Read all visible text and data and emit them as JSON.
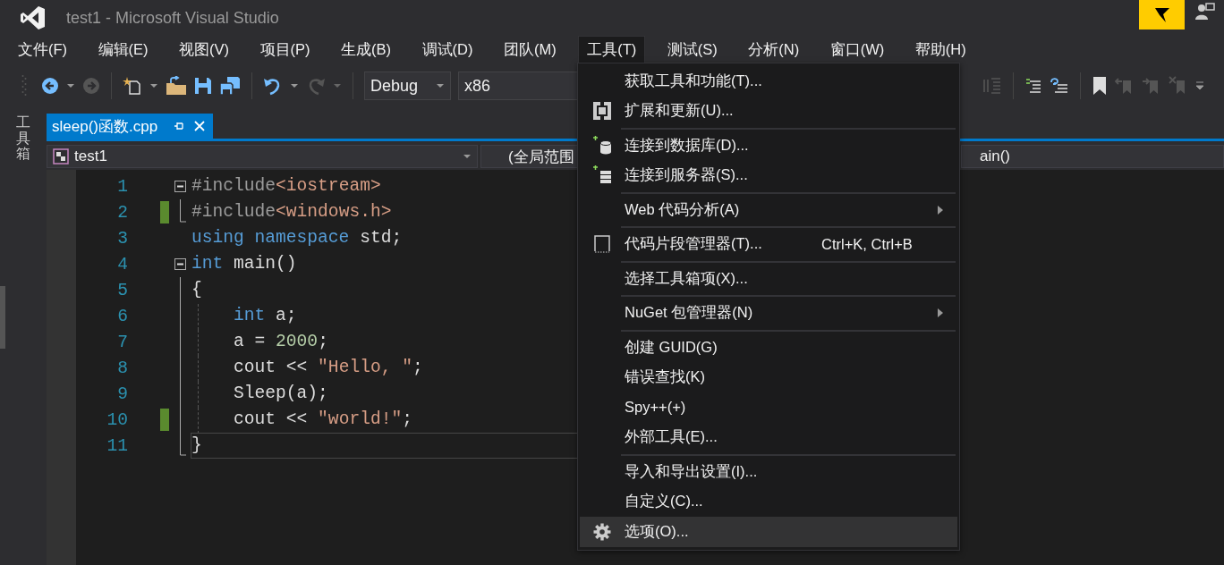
{
  "window": {
    "title": "test1 - Microsoft Visual Studio"
  },
  "menu_bar": [
    {
      "label": "文件(F)",
      "selected": false
    },
    {
      "label": "编辑(E)",
      "selected": false
    },
    {
      "label": "视图(V)",
      "selected": false
    },
    {
      "label": "项目(P)",
      "selected": false
    },
    {
      "label": "生成(B)",
      "selected": false
    },
    {
      "label": "调试(D)",
      "selected": false
    },
    {
      "label": "团队(M)",
      "selected": false
    },
    {
      "label": "工具(T)",
      "selected": true
    },
    {
      "label": "测试(S)",
      "selected": false
    },
    {
      "label": "分析(N)",
      "selected": false
    },
    {
      "label": "窗口(W)",
      "selected": false
    },
    {
      "label": "帮助(H)",
      "selected": false
    }
  ],
  "toolbar": {
    "configuration": "Debug",
    "platform": "x86"
  },
  "toolbox_tab": {
    "label": "工具箱"
  },
  "document_tabs": [
    {
      "label": "sleep()函数.cpp",
      "selected": true
    }
  ],
  "navigation_bar": {
    "project": "test1",
    "scope": "(全局范围",
    "member": "ain()"
  },
  "editor": {
    "lines": [
      {
        "number": "1",
        "fold_start": true,
        "fold_end": false,
        "changed": false,
        "guide": false,
        "current": false,
        "tokens": [
          {
            "text": "#include",
            "kind": "directive"
          },
          {
            "text": "<iostream>",
            "kind": "string"
          }
        ]
      },
      {
        "number": "2",
        "fold_start": false,
        "fold_end": true,
        "changed": true,
        "guide": false,
        "current": false,
        "tokens": [
          {
            "text": "#include",
            "kind": "directive"
          },
          {
            "text": "<windows.h>",
            "kind": "string"
          }
        ]
      },
      {
        "number": "3",
        "fold_start": false,
        "fold_end": false,
        "changed": false,
        "guide": false,
        "current": false,
        "tokens": [
          {
            "text": "using",
            "kind": "keyword"
          },
          {
            "text": " namespace",
            "kind": "keyword"
          },
          {
            "text": " std;",
            "kind": "plain"
          }
        ]
      },
      {
        "number": "4",
        "fold_start": true,
        "fold_end": false,
        "changed": false,
        "guide": false,
        "current": false,
        "tokens": [
          {
            "text": "int",
            "kind": "keyword"
          },
          {
            "text": " main()",
            "kind": "plain"
          }
        ]
      },
      {
        "number": "5",
        "fold_start": false,
        "fold_end": false,
        "changed": false,
        "guide": false,
        "current": false,
        "tokens": [
          {
            "text": "{",
            "kind": "plain"
          }
        ]
      },
      {
        "number": "6",
        "fold_start": false,
        "fold_end": false,
        "changed": false,
        "guide": true,
        "current": false,
        "tokens": [
          {
            "text": "    int",
            "kind": "keyword"
          },
          {
            "text": " a;",
            "kind": "plain"
          }
        ]
      },
      {
        "number": "7",
        "fold_start": false,
        "fold_end": false,
        "changed": false,
        "guide": true,
        "current": false,
        "tokens": [
          {
            "text": "    a = ",
            "kind": "plain"
          },
          {
            "text": "2000",
            "kind": "number"
          },
          {
            "text": ";",
            "kind": "plain"
          }
        ]
      },
      {
        "number": "8",
        "fold_start": false,
        "fold_end": false,
        "changed": false,
        "guide": true,
        "current": false,
        "tokens": [
          {
            "text": "    cout << ",
            "kind": "plain"
          },
          {
            "text": "\"Hello, \"",
            "kind": "string"
          },
          {
            "text": ";",
            "kind": "plain"
          }
        ]
      },
      {
        "number": "9",
        "fold_start": false,
        "fold_end": false,
        "changed": false,
        "guide": true,
        "current": false,
        "tokens": [
          {
            "text": "    Sleep(a);",
            "kind": "plain"
          }
        ]
      },
      {
        "number": "10",
        "fold_start": false,
        "fold_end": false,
        "changed": true,
        "guide": true,
        "current": false,
        "tokens": [
          {
            "text": "    cout << ",
            "kind": "plain"
          },
          {
            "text": "\"world!\"",
            "kind": "string"
          },
          {
            "text": ";",
            "kind": "plain"
          }
        ]
      },
      {
        "number": "11",
        "fold_start": false,
        "fold_end": true,
        "changed": false,
        "guide": false,
        "current": true,
        "tokens": [
          {
            "text": "}",
            "kind": "plain"
          }
        ]
      }
    ]
  },
  "tools_menu": {
    "groups": [
      [
        {
          "label": "获取工具和功能(T)...",
          "selected": false
        },
        {
          "label": "扩展和更新(U)...",
          "selected": false
        }
      ],
      [
        {
          "label": "连接到数据库(D)...",
          "selected": false
        },
        {
          "label": "连接到服务器(S)...",
          "selected": false
        }
      ],
      [
        {
          "label": "Web 代码分析(A)",
          "submenu": true,
          "selected": false
        }
      ],
      [
        {
          "label": "代码片段管理器(T)...",
          "shortcut": "Ctrl+K, Ctrl+B",
          "selected": false
        }
      ],
      [
        {
          "label": "选择工具箱项(X)...",
          "selected": false
        }
      ],
      [
        {
          "label": "NuGet 包管理器(N)",
          "submenu": true,
          "selected": false
        }
      ],
      [
        {
          "label": "创建 GUID(G)",
          "selected": false
        },
        {
          "label": "错误查找(K)",
          "selected": false
        },
        {
          "label": "Spy++(+)",
          "selected": false
        },
        {
          "label": "外部工具(E)...",
          "selected": false
        }
      ],
      [
        {
          "label": "导入和导出设置(I)...",
          "selected": false
        },
        {
          "label": "自定义(C)...",
          "selected": false
        },
        {
          "label": "选项(O)...",
          "selected": true
        }
      ]
    ]
  }
}
